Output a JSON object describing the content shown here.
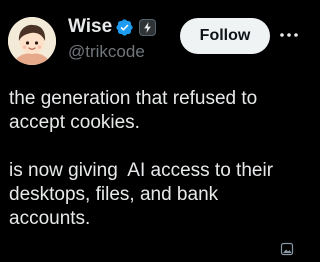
{
  "author": {
    "display_name": "Wise",
    "handle": "@trikcode",
    "verified_icon": "verified-badge-icon",
    "affiliate_icon": "lightning-badge-icon"
  },
  "actions": {
    "follow_label": "Follow",
    "more_icon": "more-options-icon"
  },
  "tweet": {
    "paragraphs": [
      "the generation that refused to\naccept cookies.",
      "is now giving  AI access to their\ndesktops, files, and bank\naccounts."
    ]
  },
  "colors": {
    "background": "#000000",
    "text": "#e7e9ea",
    "secondary_text": "#71767b",
    "verified_blue": "#1d9bf0",
    "follow_bg": "#eff3f4",
    "follow_text": "#0f1419"
  }
}
